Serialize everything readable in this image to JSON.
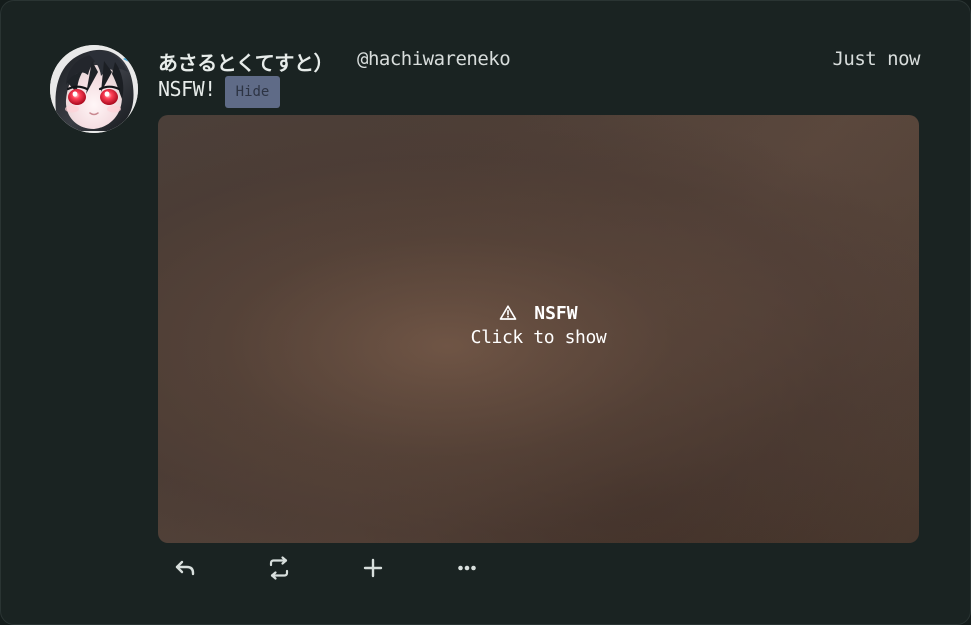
{
  "post": {
    "author": {
      "display_name": "あさるとくてすと）",
      "handle": "@hachiwareneko",
      "avatar_icon": "user-avatar-icon"
    },
    "timestamp": "Just now",
    "content_warning": {
      "text": "NSFW!",
      "toggle_label": "Hide"
    },
    "media": {
      "overlay_title": "NSFW",
      "overlay_subtitle": "Click to show",
      "icon": "warning-icon"
    },
    "actions": {
      "reply_icon": "reply-icon",
      "renote_icon": "renote-icon",
      "react_icon": "plus-icon",
      "more_icon": "more-icon"
    }
  },
  "colors": {
    "background": "#141c1b",
    "card": "#1a2322",
    "text_primary": "#e7ecea",
    "hide_button": "#5f6b87",
    "media_overlay": "#ffffff"
  }
}
